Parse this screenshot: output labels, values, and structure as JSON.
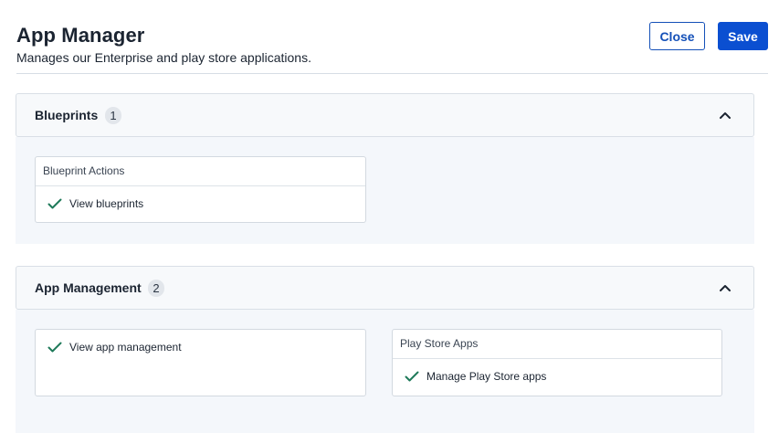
{
  "header": {
    "title": "App Manager",
    "subtitle": "Manages our Enterprise and play store applications.",
    "close_label": "Close",
    "save_label": "Save"
  },
  "colors": {
    "primary": "#0b4fd1",
    "check": "#1f7a5a",
    "section_bg": "#f4f7fb"
  },
  "sections": [
    {
      "title": "Blueprints",
      "count": "1",
      "expanded": true,
      "icon": "chevron-up-icon",
      "cards": [
        {
          "heading": "Blueprint Actions",
          "permissions": [
            {
              "label": "View blueprints",
              "checked": true,
              "icon": "check-icon"
            }
          ]
        }
      ]
    },
    {
      "title": "App Management",
      "count": "2",
      "expanded": true,
      "icon": "chevron-up-icon",
      "cards": [
        {
          "heading": "",
          "permissions": [
            {
              "label": "View app management",
              "checked": true,
              "icon": "check-icon"
            }
          ]
        },
        {
          "heading": "Play Store Apps",
          "permissions": [
            {
              "label": "Manage Play Store apps",
              "checked": true,
              "icon": "check-icon"
            }
          ]
        }
      ]
    }
  ]
}
